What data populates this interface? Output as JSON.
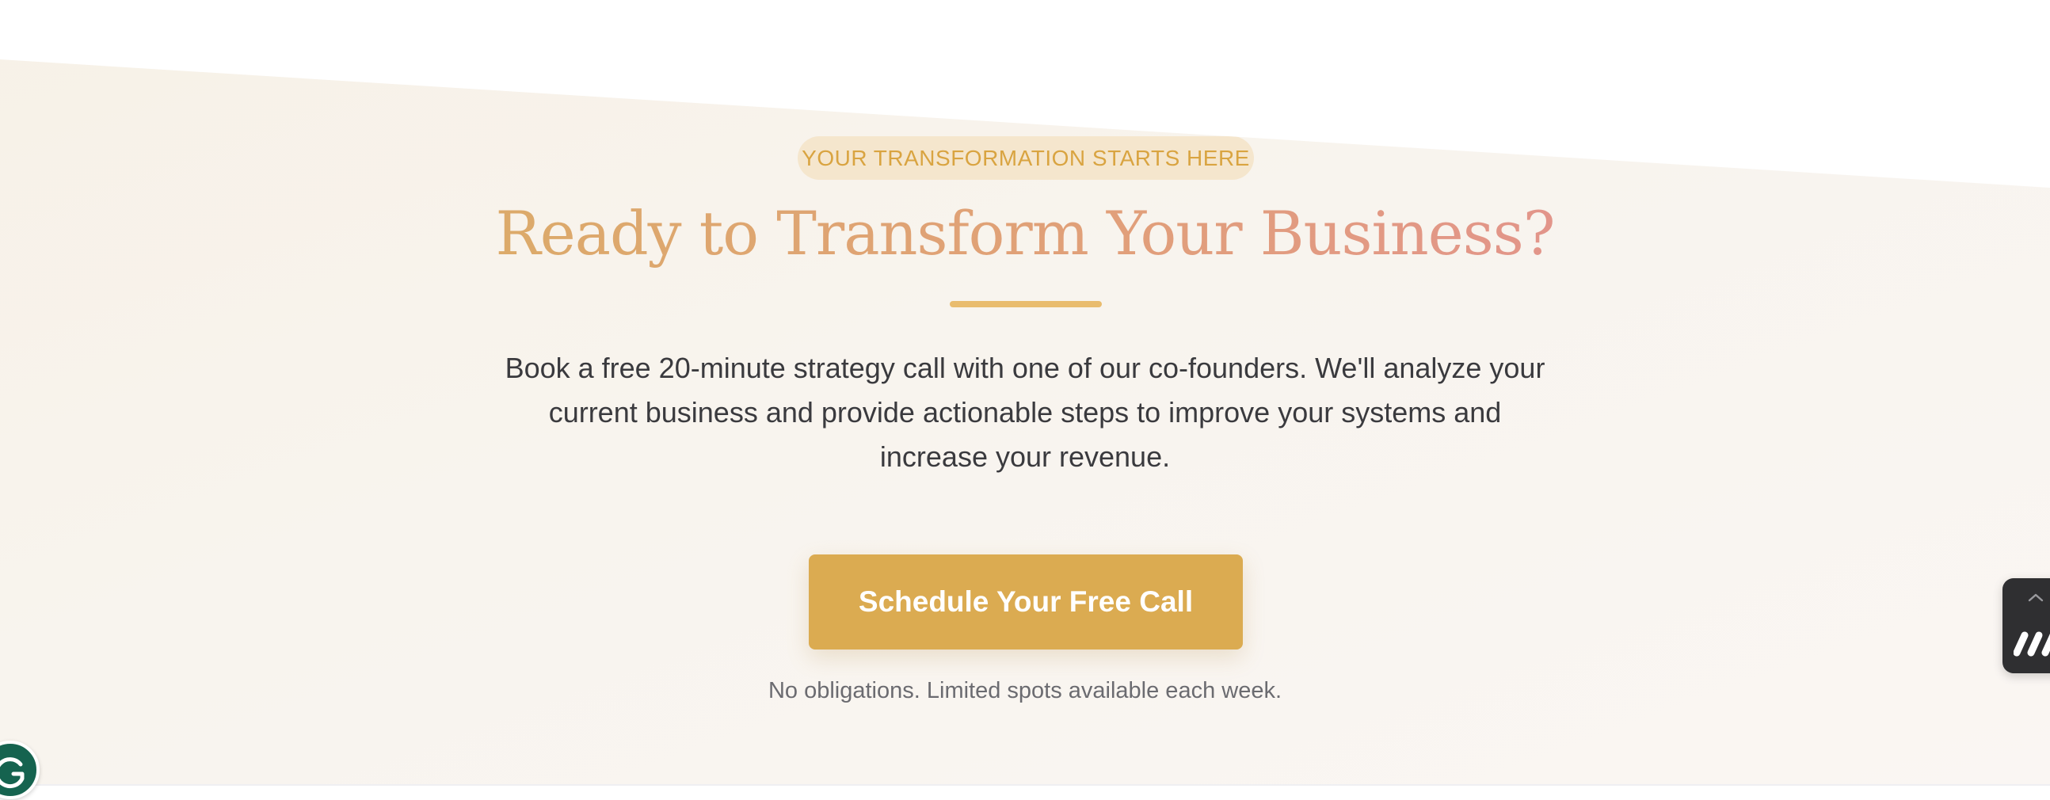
{
  "cta": {
    "eyebrow": "YOUR TRANSFORMATION STARTS HERE",
    "headline": "Ready to Transform Your Business?",
    "description": "Book a free 20-minute strategy call with one of our co-founders. We'll analyze your current business and provide actionable steps to improve your systems and increase your revenue.",
    "button_label": "Schedule Your Free Call",
    "footnote": "No obligations. Limited spots available each week."
  },
  "widgets": {
    "grammarly_icon": "grammarly-g-icon",
    "side_widget_icons": [
      "chevron-up-icon",
      "make-logo-icon"
    ]
  },
  "colors": {
    "accent_gold": "#dbab51",
    "headline_start": "#dcaa6a",
    "headline_end": "#e2958a",
    "eyebrow_bg": "#f5e6cd",
    "eyebrow_text": "#d9a441",
    "body_text": "#3a3a3e",
    "muted_text": "#6b6b70",
    "section_bg": "#f8f4ee"
  }
}
